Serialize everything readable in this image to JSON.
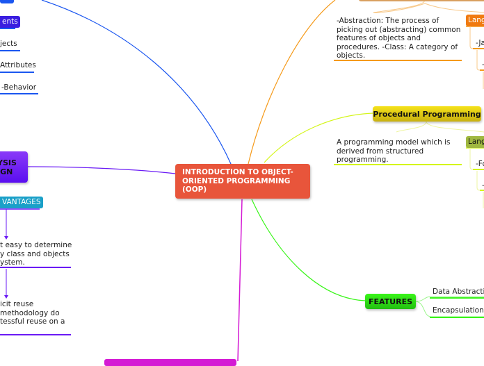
{
  "central": {
    "title": "INTRODUCTION TO OBJECT-ORIENTED PROGRAMMING (OOP)"
  },
  "left_top": {
    "tag": "ents",
    "items": [
      "jects",
      "Attributes",
      "-Behavior"
    ]
  },
  "analysis_node": {
    "title": "YSIS\nIGN"
  },
  "advantages": {
    "tag": "VANTAGES",
    "items": [
      "t easy to determine\ny class and objects\nystem.",
      "icit reuse\nmethodology do\ntessful reuse on a"
    ]
  },
  "oop_branch": {
    "description": "-Abstraction: The process of picking out (abstracting) common features of objects and procedures.\n-Class: A category of objects.",
    "languages_tag": "Lang",
    "languages": [
      "-Ja",
      "-"
    ]
  },
  "procedural": {
    "title": "Procedural Programming",
    "description": "A programming model which is derived from structured programming.",
    "languages_tag": "Lang",
    "languages": [
      "-Fo",
      "-"
    ]
  },
  "features": {
    "title": "FEATURES",
    "items": [
      "Data Abstraction",
      "Encapsulation"
    ]
  },
  "colors": {
    "central": "#e8553b",
    "blue": "#1a56f0",
    "purple": "#6a1af5",
    "orange": "#f59a1a",
    "yellow_green": "#d4f51a",
    "green": "#3af51a",
    "magenta": "#d41ad4",
    "teal": "#1aa0c8"
  }
}
